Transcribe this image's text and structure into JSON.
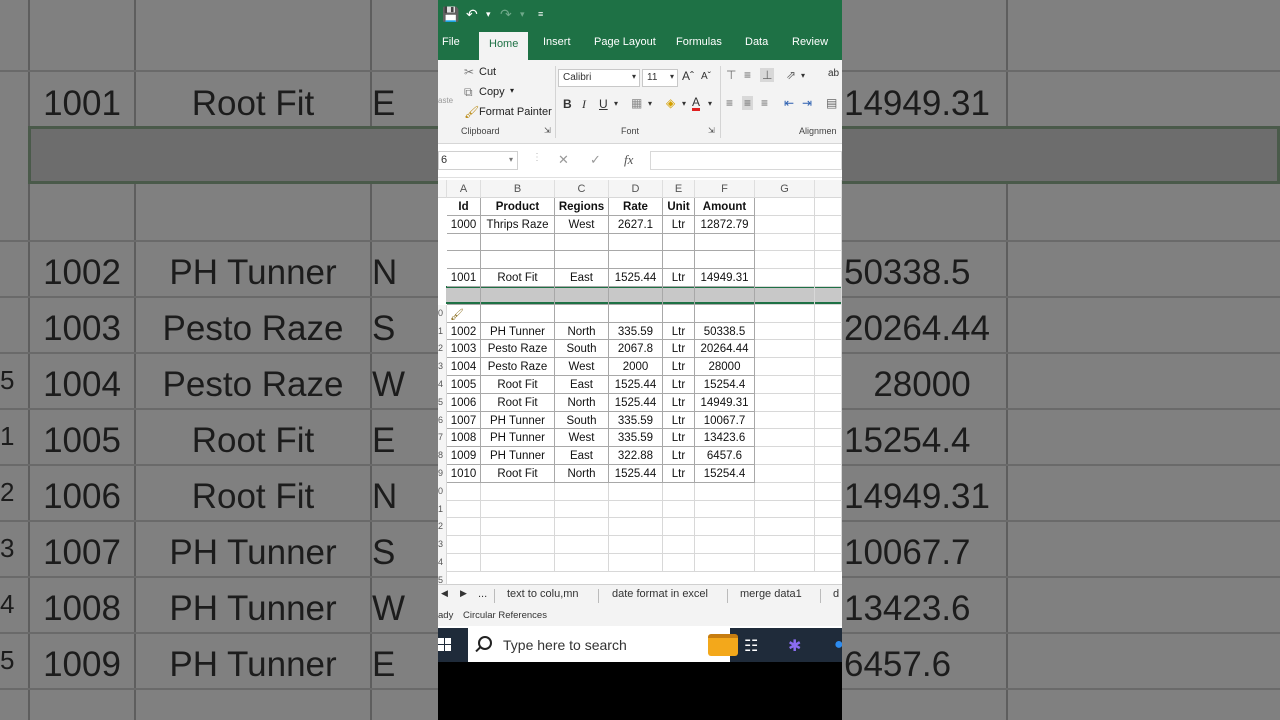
{
  "background": {
    "rows": [
      {
        "id": "1001",
        "product": "Root Fit",
        "region": "E",
        "amount": "14949.31"
      },
      {
        "id": "1002",
        "product": "PH Tunner",
        "region": "N",
        "amount": "50338.5"
      },
      {
        "id": "1003",
        "product": "Pesto Raze",
        "region": "S",
        "amount": "20264.44"
      },
      {
        "id": "1004",
        "product": "Pesto Raze",
        "region": "W",
        "amount": "28000"
      },
      {
        "id": "1005",
        "product": "Root Fit",
        "region": "E",
        "amount": "15254.4"
      },
      {
        "id": "1006",
        "product": "Root Fit",
        "region": "N",
        "amount": "14949.31"
      },
      {
        "id": "1007",
        "product": "PH Tunner",
        "region": "S",
        "amount": "10067.7"
      },
      {
        "id": "1008",
        "product": "PH Tunner",
        "region": "W",
        "amount": "13423.6"
      },
      {
        "id": "1009",
        "product": "PH Tunner",
        "region": "E",
        "amount": "6457.6"
      }
    ],
    "side_numbers": [
      "5",
      "1",
      "2",
      "3",
      "4",
      "5"
    ]
  },
  "colors": {
    "excel_green": "#1e7145",
    "selection_gray": "#c8c8c8",
    "taskbar": "#1f2b3a"
  },
  "ribbon_tabs": [
    "File",
    "Home",
    "Insert",
    "Page Layout",
    "Formulas",
    "Data",
    "Review"
  ],
  "active_tab": "Home",
  "clipboard": {
    "paste_label": "aste",
    "cut": "Cut",
    "copy": "Copy",
    "format_painter": "Format Painter",
    "group_label": "Clipboard"
  },
  "font": {
    "name": "Calibri",
    "size": "11",
    "group_label": "Font"
  },
  "alignment": {
    "group_label": "Alignmen",
    "wrap_label": "ab"
  },
  "formula_bar": {
    "name_box": "6",
    "fx": "fx"
  },
  "columns": [
    "A",
    "B",
    "C",
    "D",
    "E",
    "F",
    "G"
  ],
  "table": {
    "headers": [
      "Id",
      "Product",
      "Regions",
      "Rate",
      "Unit",
      "Amount"
    ],
    "rows": [
      [
        "1000",
        "Thrips Raze",
        "West",
        "2627.1",
        "Ltr",
        "12872.79"
      ],
      [
        "",
        "",
        "",
        "",
        "",
        ""
      ],
      [
        "",
        "",
        "",
        "",
        "",
        ""
      ],
      [
        "1001",
        "Root Fit",
        "East",
        "1525.44",
        "Ltr",
        "14949.31"
      ],
      [
        "",
        "",
        "",
        "",
        "",
        ""
      ],
      [
        "",
        "",
        "",
        "",
        "",
        ""
      ],
      [
        "1002",
        "PH Tunner",
        "North",
        "335.59",
        "Ltr",
        "50338.5"
      ],
      [
        "1003",
        "Pesto Raze",
        "South",
        "2067.8",
        "Ltr",
        "20264.44"
      ],
      [
        "1004",
        "Pesto Raze",
        "West",
        "2000",
        "Ltr",
        "28000"
      ],
      [
        "1005",
        "Root Fit",
        "East",
        "1525.44",
        "Ltr",
        "15254.4"
      ],
      [
        "1006",
        "Root Fit",
        "North",
        "1525.44",
        "Ltr",
        "14949.31"
      ],
      [
        "1007",
        "PH Tunner",
        "South",
        "335.59",
        "Ltr",
        "10067.7"
      ],
      [
        "1008",
        "PH Tunner",
        "West",
        "335.59",
        "Ltr",
        "13423.6"
      ],
      [
        "1009",
        "PH Tunner",
        "East",
        "322.88",
        "Ltr",
        "6457.6"
      ],
      [
        "1010",
        "Root Fit",
        "North",
        "1525.44",
        "Ltr",
        "15254.4"
      ]
    ]
  },
  "row_header_digits": [
    "0",
    "1",
    "2",
    "3",
    "4",
    "5",
    "6",
    "7",
    "8",
    "9",
    "0",
    "1",
    "2",
    "3",
    "4",
    "5"
  ],
  "sheet_tabs": {
    "more": "...",
    "tabs": [
      "text to colu,mn",
      "date format in excel",
      "merge data1",
      "d"
    ]
  },
  "status": {
    "mode": "ady",
    "circular": "Circular References"
  },
  "taskbar": {
    "search_placeholder": "Type here to search"
  }
}
